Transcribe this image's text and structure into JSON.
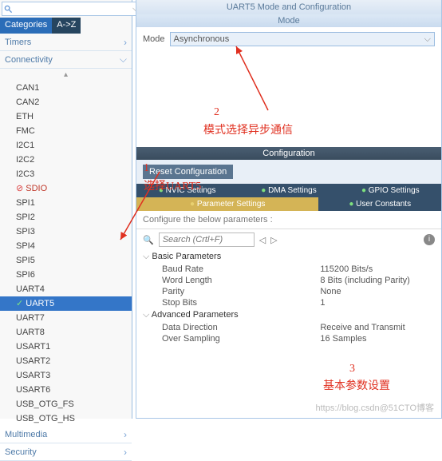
{
  "search": {
    "placeholder": ""
  },
  "tabs": {
    "categories": "Categories",
    "az": "A->Z"
  },
  "sections": {
    "timers": "Timers",
    "connectivity": "Connectivity",
    "multimedia": "Multimedia",
    "security": "Security"
  },
  "periphs": {
    "can1": "CAN1",
    "can2": "CAN2",
    "eth": "ETH",
    "fmc": "FMC",
    "i2c1": "I2C1",
    "i2c2": "I2C2",
    "i2c3": "I2C3",
    "sdio": "SDIO",
    "spi1": "SPI1",
    "spi2": "SPI2",
    "spi3": "SPI3",
    "spi4": "SPI4",
    "spi5": "SPI5",
    "spi6": "SPI6",
    "uart4": "UART4",
    "uart5": "UART5",
    "uart7": "UART7",
    "uart8": "UART8",
    "usart1": "USART1",
    "usart2": "USART2",
    "usart3": "USART3",
    "usart6": "USART6",
    "otgfs": "USB_OTG_FS",
    "otghs": "USB_OTG_HS"
  },
  "header": {
    "title": "UART5 Mode and Configuration"
  },
  "mode": {
    "band": "Mode",
    "label": "Mode",
    "value": "Asynchronous"
  },
  "config": {
    "band": "Configuration",
    "reset": "Reset Configuration",
    "tabs": {
      "nvic": "NVIC Settings",
      "dma": "DMA Settings",
      "gpio": "GPIO Settings",
      "param": "Parameter Settings",
      "user": "User Constants"
    },
    "label": "Configure the below parameters :",
    "filter": "Search (Crtl+F)",
    "groups": {
      "basic": "Basic Parameters",
      "advanced": "Advanced Parameters"
    },
    "rows": {
      "baud_k": "Baud Rate",
      "baud_v": "115200 Bits/s",
      "word_k": "Word Length",
      "word_v": "8 Bits (including Parity)",
      "parity_k": "Parity",
      "parity_v": "None",
      "stop_k": "Stop Bits",
      "stop_v": "1",
      "dir_k": "Data Direction",
      "dir_v": "Receive and Transmit",
      "over_k": "Over Sampling",
      "over_v": "16 Samples"
    }
  },
  "annotations": {
    "a1_num": "1",
    "a1_txt": "选择UART5",
    "a2_num": "2",
    "a2_txt": "模式选择异步通信",
    "a3_num": "3",
    "a3_txt": "基本参数设置"
  },
  "watermark": "https://blog.csdn@51CTO博客"
}
